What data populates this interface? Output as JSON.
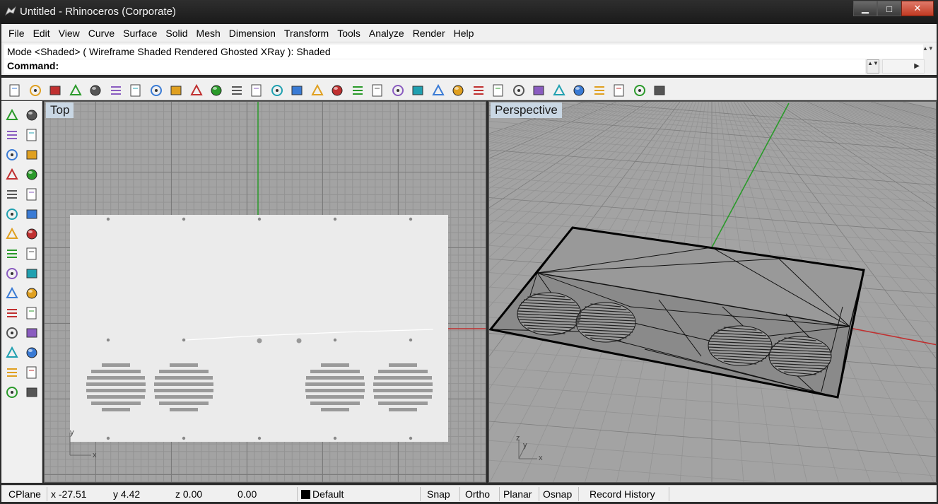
{
  "window": {
    "title": "Untitled - Rhinoceros (Corporate)",
    "min_glyph": "▁",
    "max_glyph": "□",
    "close_glyph": "✕"
  },
  "menu": [
    "File",
    "Edit",
    "View",
    "Curve",
    "Surface",
    "Solid",
    "Mesh",
    "Dimension",
    "Transform",
    "Tools",
    "Analyze",
    "Render",
    "Help"
  ],
  "command": {
    "history": "Mode <Shaded> ( Wireframe  Shaded  Rendered  Ghosted  XRay ): Shaded",
    "prompt": "Command:",
    "history_scroll": "▲▼",
    "spin": "▲▼",
    "scroll": "▶"
  },
  "toolbar_icons": [
    "new-file-icon",
    "open-file-icon",
    "save-icon",
    "print-icon",
    "import-icon",
    "cut-icon",
    "copy-icon",
    "paste-icon",
    "undo-icon",
    "pan-icon",
    "rotate-view-icon",
    "zoom-icon",
    "zoom-window-icon",
    "zoom-extents-icon",
    "zoom-selected-icon",
    "undo-view-icon",
    "four-viewports-icon",
    "car-icon",
    "render-grid-icon",
    "cplane-icon",
    "osnap-icon",
    "light-icon",
    "bulb-icon",
    "lock-icon",
    "layers-icon",
    "color-wheel-icon",
    "wireframe-sphere-icon",
    "mesh-sphere-icon",
    "shaded-sphere-icon",
    "render-icon",
    "settings-icon",
    "group-icon",
    "help-icon"
  ],
  "palette_icons": [
    "select-icon",
    "point-icon",
    "polyline-icon",
    "curve-icon",
    "circle-icon",
    "ellipse-icon",
    "arc-icon",
    "rectangle-icon",
    "polygon-icon",
    "fillet-icon",
    "surface-icon",
    "revolve-icon",
    "box-icon",
    "sphere-icon",
    "cylinder-icon",
    "mesh-icon",
    "explode-icon",
    "boolean-icon",
    "trim-icon",
    "split-icon",
    "move-icon",
    "group-icon",
    "rotate-icon",
    "offset-icon",
    "text-icon",
    "dimension-icon",
    "array-icon",
    "history-icon",
    "cage-icon",
    "bar-icon"
  ],
  "viewports": {
    "top": {
      "label": "Top",
      "axis_x": "x",
      "axis_y": "y",
      "rows_left_grille": [
        40,
        70,
        82,
        84,
        84,
        82,
        70,
        40
      ]
    },
    "perspective": {
      "label": "Perspective",
      "axis_x": "x",
      "axis_y": "y",
      "axis_z": "z"
    }
  },
  "statusbar": {
    "cplane": "CPlane",
    "x": "x -27.51",
    "y": "y 4.42",
    "z": "z 0.00",
    "d": "0.00",
    "layer": "Default",
    "snap": "Snap",
    "ortho": "Ortho",
    "planar": "Planar",
    "osnap": "Osnap",
    "record": "Record History"
  },
  "colors": {
    "green_axis": "#2a9a2a",
    "red_axis": "#c03030",
    "viewport_bg": "#a3a3a3",
    "label_bg": "#c9d7e4"
  }
}
